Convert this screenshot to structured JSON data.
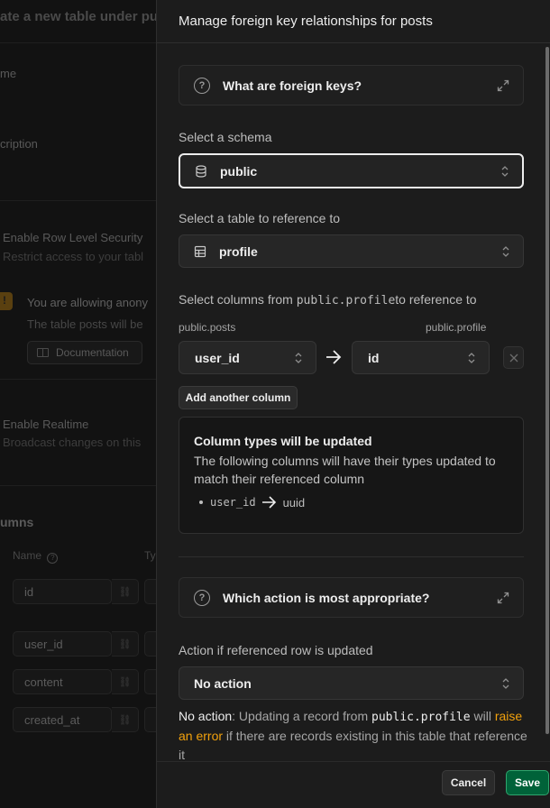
{
  "background": {
    "title_prefix": "ate a new table under",
    "title_schema": "pu",
    "name_label": "me",
    "description_label": "cription",
    "rls_label": "Enable Row Level Security",
    "rls_sub": "Restrict access to your tabl",
    "warning_title": "You are allowing anony",
    "warning_text": "The table posts will be",
    "doc_button": "Documentation",
    "realtime_label": "Enable Realtime",
    "realtime_sub": "Broadcast changes on this",
    "columns_heading": "umns",
    "col_header_name": "Name",
    "col_header_type": "Ty",
    "columns": [
      "id",
      "user_id",
      "content",
      "created_at"
    ]
  },
  "panel": {
    "title": "Manage foreign key relationships for posts",
    "faq1": "What are foreign keys?",
    "schema_label": "Select a schema",
    "schema_value": "public",
    "table_label": "Select a table to reference to",
    "table_value": "profile",
    "columns_label_prefix": "Select columns from ",
    "columns_label_code": "public.profile",
    "columns_label_suffix": "to reference to",
    "source_table": "public.posts",
    "target_table": "public.profile",
    "source_column": "user_id",
    "target_column": "id",
    "add_column_button": "Add another column",
    "callout_title": "Column types will be updated",
    "callout_text": "The following columns will have their types updated to match their referenced column",
    "callout_column": "user_id",
    "callout_type": "uuid",
    "faq2": "Which action is most appropriate?",
    "action_label": "Action if referenced row is updated",
    "action_value": "No action",
    "help_strong": "No action",
    "help_1": ": Updating a record from ",
    "help_code": "public.profile",
    "help_2": " will ",
    "help_accent": "raise an error",
    "help_3": " if there are records existing in this table that reference it"
  },
  "footer": {
    "cancel": "Cancel",
    "save": "Save"
  },
  "colors": {
    "accent": "#f1a10d",
    "save_green": "#006239",
    "panel_bg": "#1c1c1c"
  }
}
